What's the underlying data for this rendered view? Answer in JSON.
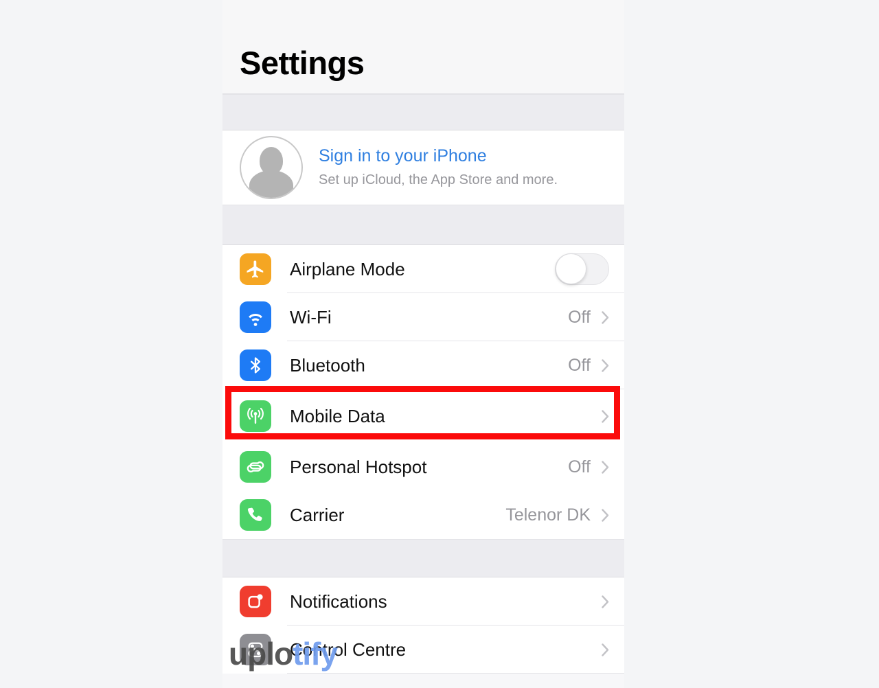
{
  "screen": {
    "title": "Settings"
  },
  "account": {
    "title": "Sign in to your iPhone",
    "subtitle": "Set up iCloud, the App Store and more.",
    "avatar_icon": "person-avatar-icon"
  },
  "groups": [
    {
      "id": "connectivity",
      "rows": [
        {
          "label": "Airplane Mode",
          "value": "",
          "icon": "airplane-icon",
          "control": "toggle",
          "toggle_on": false,
          "accent": "#f5a623"
        },
        {
          "label": "Wi-Fi",
          "value": "Off",
          "icon": "wifi-icon",
          "control": "chevron",
          "accent": "#1e7bf5"
        },
        {
          "label": "Bluetooth",
          "value": "Off",
          "icon": "bluetooth-icon",
          "control": "chevron",
          "accent": "#1e7bf5"
        },
        {
          "label": "Mobile Data",
          "value": "",
          "icon": "cellular-antenna-icon",
          "control": "chevron",
          "accent": "#4cd267",
          "highlighted": true
        },
        {
          "label": "Personal Hotspot",
          "value": "Off",
          "icon": "hotspot-link-icon",
          "control": "chevron",
          "accent": "#4cd267"
        },
        {
          "label": "Carrier",
          "value": "Telenor DK",
          "icon": "phone-handset-icon",
          "control": "chevron",
          "accent": "#4cd267"
        }
      ]
    },
    {
      "id": "system",
      "rows": [
        {
          "label": "Notifications",
          "value": "",
          "icon": "notifications-icon",
          "control": "chevron",
          "accent": "#f03d2f"
        },
        {
          "label": "Control Centre",
          "value": "",
          "icon": "control-centre-icon",
          "control": "chevron",
          "accent": "#8e8e93"
        }
      ]
    }
  ],
  "highlight": {
    "target": "Mobile Data",
    "color": "#fb0b0b"
  },
  "watermark": {
    "part_a": "uplo",
    "part_b": "tify"
  },
  "colors": {
    "page_background": "#f4f5f7",
    "card": "#ffffff",
    "group_gap": "#ececf0",
    "link_blue": "#2f7fe0",
    "secondary_text": "#96969b",
    "separator": "#e4e4e8"
  }
}
